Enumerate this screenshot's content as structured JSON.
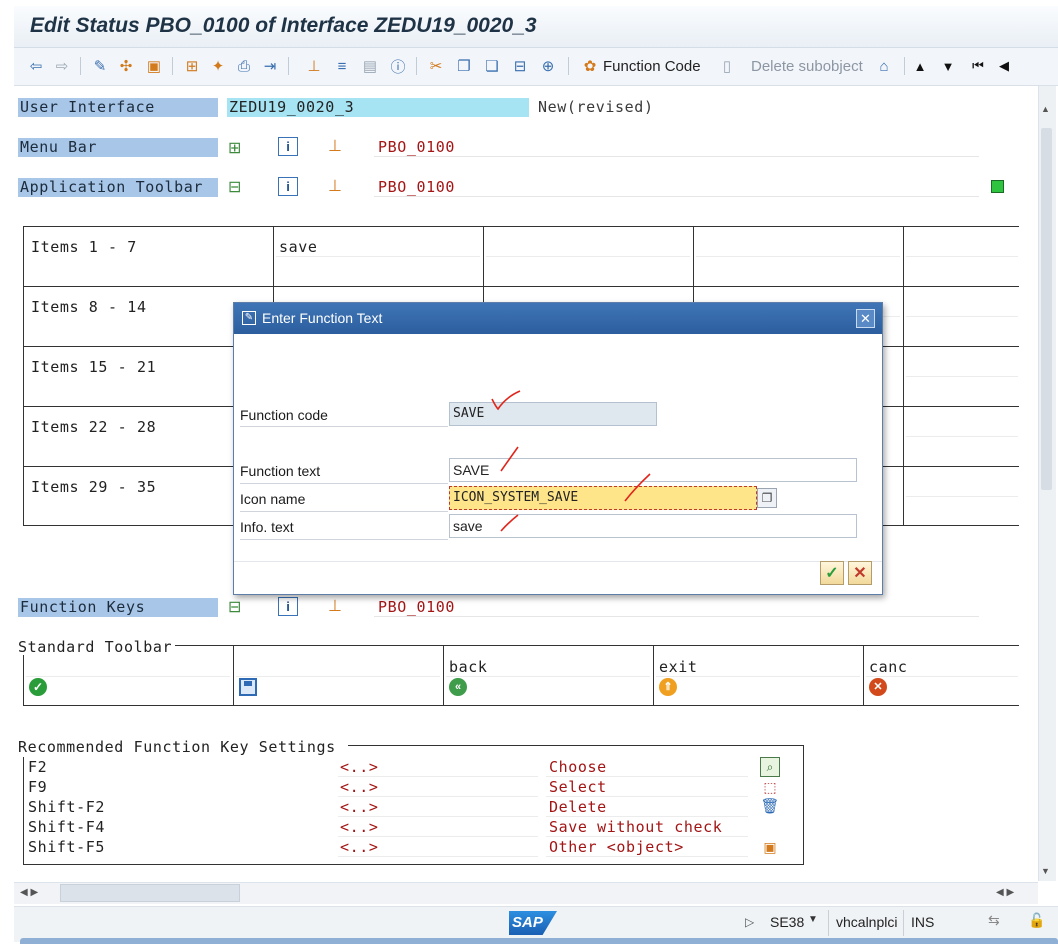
{
  "window": {
    "title": "Edit Status PBO_0100 of Interface ZEDU19_0020_3"
  },
  "toolbar": {
    "function_code_label": "Function Code",
    "delete_subobject_label": "Delete subobject"
  },
  "header": {
    "user_interface_label": "User Interface",
    "user_interface_value": "ZEDU19_0020_3",
    "user_interface_status": "New(revised)",
    "menu_bar_label": "Menu Bar",
    "menu_bar_value": "PBO_0100",
    "app_toolbar_label": "Application Toolbar",
    "app_toolbar_value": "PBO_0100"
  },
  "items_grid": {
    "rows": [
      {
        "label": "Items  1 -  7",
        "first": "save"
      },
      {
        "label": "Items  8 - 14",
        "first": ""
      },
      {
        "label": "Items 15 - 21",
        "first": ""
      },
      {
        "label": "Items 22 - 28",
        "first": ""
      },
      {
        "label": "Items 29 - 35",
        "first": ""
      }
    ]
  },
  "function_keys": {
    "label": "Function Keys",
    "value": "PBO_0100"
  },
  "standard_toolbar": {
    "label": "Standard Toolbar",
    "cells": [
      {
        "text": "",
        "icon": "check-icon"
      },
      {
        "text": "",
        "icon": "save-disk-icon"
      },
      {
        "text": "back",
        "icon": "back-icon"
      },
      {
        "text": "exit",
        "icon": "exit-icon"
      },
      {
        "text": "canc",
        "icon": "cancel-icon"
      }
    ]
  },
  "recommended": {
    "label": "Recommended Function Key Settings",
    "rows": [
      {
        "key": "F2",
        "value": "<..>",
        "action": "Choose",
        "icon": "choose-icon"
      },
      {
        "key": "F9",
        "value": "<..>",
        "action": "Select",
        "icon": "select-icon"
      },
      {
        "key": "Shift-F2",
        "value": "<..>",
        "action": "Delete",
        "icon": "trash-icon"
      },
      {
        "key": "Shift-F4",
        "value": "<..>",
        "action": "Save without check",
        "icon": ""
      },
      {
        "key": "Shift-F5",
        "value": "<..>",
        "action": "Other <object>",
        "icon": "other-object-icon"
      }
    ]
  },
  "dialog": {
    "title": "Enter Function Text",
    "function_code_label": "Function code",
    "function_code_value": "SAVE",
    "function_text_label": "Function text",
    "function_text_value": "SAVE",
    "icon_name_label": "Icon name",
    "icon_name_value": "ICON_SYSTEM_SAVE",
    "info_text_label": "Info. text",
    "info_text_value": "save"
  },
  "statusbar": {
    "logo": "SAP",
    "transaction": "SE38",
    "server": "vhcalnplci",
    "mode": "INS"
  },
  "colors": {
    "label_blue": "#a8c6e8",
    "cyan_field": "#a6e4f4",
    "red_text": "#a31515",
    "dialog_header": "#2c5e9e",
    "icon_field_highlight": "#ffe58a",
    "status_green": "#2ec440"
  }
}
